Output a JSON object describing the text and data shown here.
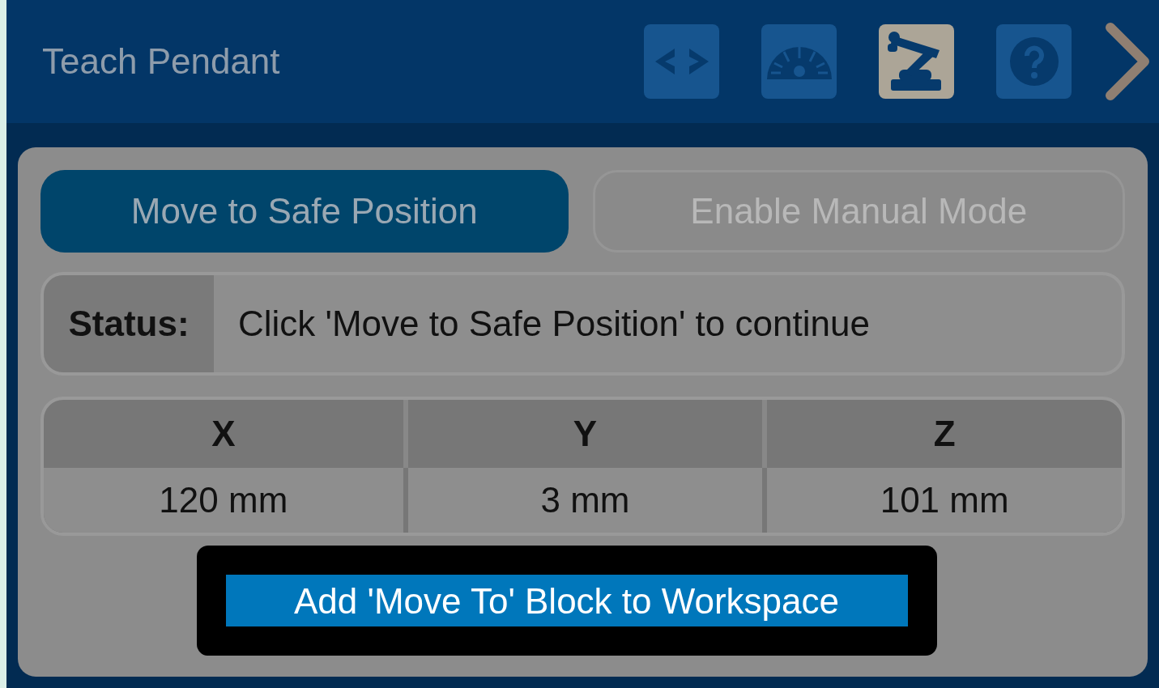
{
  "header": {
    "title": "Teach Pendant",
    "tools": [
      {
        "kind": "code",
        "selected": false
      },
      {
        "kind": "gauge",
        "selected": false
      },
      {
        "kind": "robot",
        "selected": true
      },
      {
        "kind": "help",
        "selected": false
      }
    ]
  },
  "actions": [
    {
      "label": "Move to Safe Position",
      "disabled": false
    },
    {
      "label": "Enable Manual Mode",
      "disabled": true
    }
  ],
  "status": {
    "label": "Status:",
    "message": "Click 'Move to Safe Position' to continue"
  },
  "position_table": {
    "columns": [
      "X",
      "Y",
      "Z"
    ],
    "values": [
      "120 mm",
      "3 mm",
      "101 mm"
    ]
  },
  "add_block_button": {
    "label": "Add 'Move To' Block to Workspace",
    "highlighted": true
  }
}
